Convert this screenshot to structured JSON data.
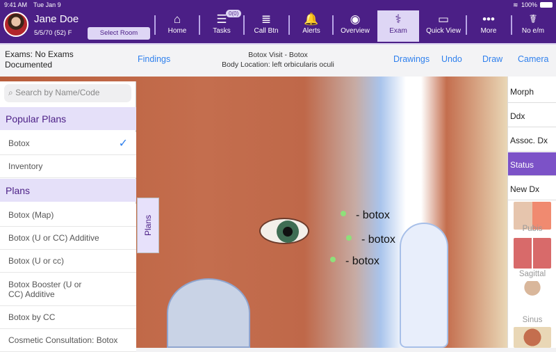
{
  "status_bar": {
    "time": "9:41 AM",
    "date": "Tue Jan 9",
    "battery": "100%"
  },
  "patient": {
    "name": "Jane Doe",
    "dob_age_sex": "5/5/70 (52) F",
    "select_room": "Select Room"
  },
  "nav": [
    {
      "label": "Home",
      "icon": "⌂"
    },
    {
      "label": "Tasks",
      "icon": "☰",
      "badge": "0(0)"
    },
    {
      "label": "Call Btn",
      "icon": "≣"
    },
    {
      "label": "Alerts",
      "icon": "🔔"
    },
    {
      "label": "Overview",
      "icon": "◉"
    },
    {
      "label": "Exam",
      "icon": "⚕",
      "active": true
    },
    {
      "label": "Quick View",
      "icon": "▭"
    },
    {
      "label": "More",
      "icon": "•••"
    },
    {
      "label": "No e/m",
      "icon": "☤"
    }
  ],
  "subbar": {
    "exams": "Exams: No Exams Documented",
    "findings": "Findings",
    "visit": "Botox Visit - Botox",
    "body_location": "Body Location: left orbicularis oculi",
    "drawings": "Drawings",
    "undo": "Undo",
    "draw": "Draw",
    "camera": "Camera"
  },
  "left_panel": {
    "search_placeholder": "Search by Name/Code",
    "popular_header": "Popular Plans",
    "popular": [
      {
        "label": "Botox",
        "checked": true
      },
      {
        "label": "Inventory"
      }
    ],
    "plans_header": "Plans",
    "plans": [
      "Botox (Map)",
      "Botox (U or CC) Additive",
      "Botox (U or cc)",
      "Botox Booster (U or CC) Additive",
      "Botox by CC",
      "Cosmetic Consultation: Botox"
    ],
    "tab": "Plans"
  },
  "markers": [
    "- botox",
    "- botox",
    "- botox"
  ],
  "right_panel": {
    "buttons": [
      "Morph",
      "Ddx",
      "Assoc. Dx",
      "Status",
      "New Dx"
    ],
    "active": "Status",
    "thumbnails": [
      "Pubis",
      "Sagittal",
      "Sinus"
    ]
  }
}
